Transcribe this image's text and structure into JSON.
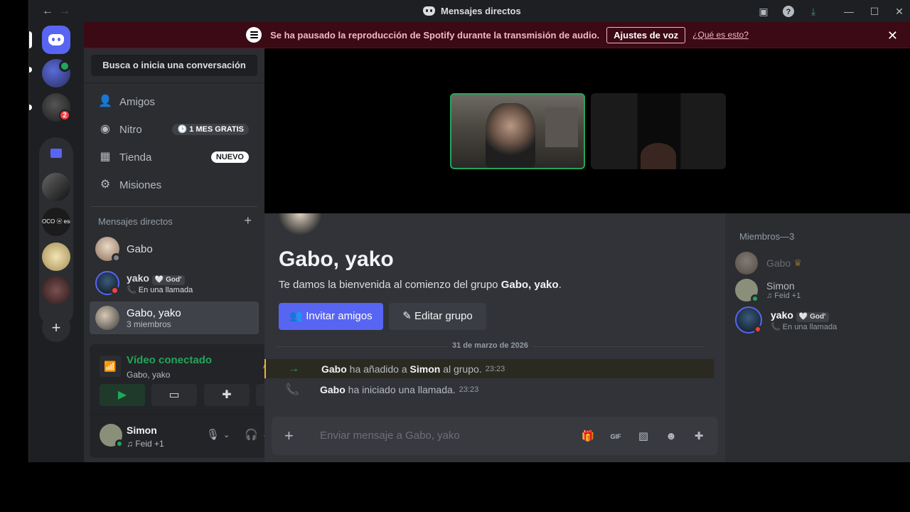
{
  "window": {
    "title": "Mensajes directos",
    "back_icon": "←",
    "forward_icon": "→"
  },
  "banner": {
    "text": "Se ha pausado la reproducción de Spotify durante la transmisión de audio.",
    "button": "Ajustes de voz",
    "link": "¿Qué es esto?",
    "close": "✕"
  },
  "servers": {
    "badge_count": "2",
    "folder_label": "OCO ⓦ esc"
  },
  "sidebar": {
    "search": "Busca o inicia una conversación",
    "nav": [
      {
        "label": "Amigos",
        "icon": "friends-icon"
      },
      {
        "label": "Nitro",
        "icon": "nitro-icon",
        "tag": "🕒 1 MES GRATIS"
      },
      {
        "label": "Tienda",
        "icon": "shop-icon",
        "tag": "NUEVO"
      },
      {
        "label": "Misiones",
        "icon": "quests-icon"
      }
    ],
    "dm_header": "Mensajes directos",
    "dms": [
      {
        "name": "Gabo",
        "sub": ""
      },
      {
        "name": "yako",
        "tag": "🤍 God'",
        "sub": "📞 En una llamada"
      },
      {
        "name": "Gabo, yako",
        "sub": "3 miembros"
      }
    ]
  },
  "voice": {
    "status": "Vídeo conectado",
    "channel": "Gabo, yako"
  },
  "user": {
    "name": "Simon",
    "status": "♫ Feid +1"
  },
  "chat": {
    "title": "Gabo, yako",
    "welcome_prefix": "Te damos la bienvenida al comienzo del grupo ",
    "welcome_group": "Gabo, yako",
    "welcome_suffix": ".",
    "invite_button": "Invitar amigos",
    "edit_button": "Editar grupo",
    "date": "31 de marzo de 2026",
    "messages": [
      {
        "actor": "Gabo",
        "text1": " ha añadido a ",
        "target": "Simon",
        "text2": " al grupo.",
        "time": "23:23",
        "icon": "→"
      },
      {
        "actor": "Gabo",
        "text1": " ha iniciado una llamada.",
        "target": "",
        "text2": "",
        "time": "23:23",
        "icon": "📞"
      }
    ],
    "composer_placeholder": "Enviar mensaje a Gabo, yako"
  },
  "members": {
    "header": "Miembros—3",
    "list": [
      {
        "name": "Gabo",
        "crown": "♛",
        "sub": ""
      },
      {
        "name": "Simon",
        "sub": "♫ Feid +1"
      },
      {
        "name": "yako",
        "tag": "🤍 God'",
        "sub": "📞 En una llamada"
      }
    ]
  },
  "colors": {
    "accent": "#5865f2",
    "online": "#23a55a",
    "dnd": "#f23f43",
    "banner_bg": "#3b0a14"
  }
}
